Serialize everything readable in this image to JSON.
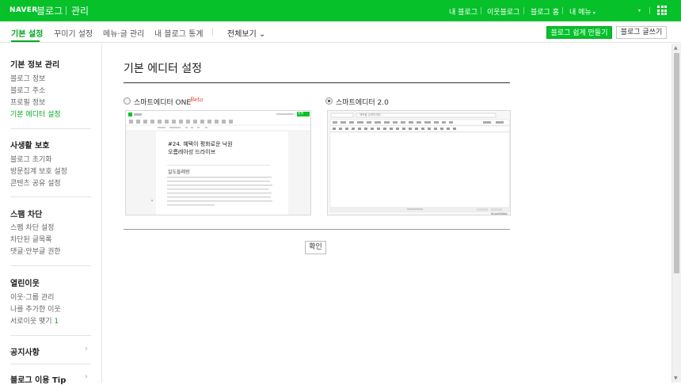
{
  "topbar": {
    "naver": "NAVER",
    "blog": "블로그",
    "manage": "관리",
    "links": [
      "내 블로그",
      "이웃블로그",
      "블로그 홈",
      "내 메뉴"
    ],
    "caret": "▾",
    "more_caret": "▾"
  },
  "subnav": {
    "tabs": [
      "기본 설정",
      "꾸미기 설정",
      "메뉴·글 관리",
      "내 블로그 통계"
    ],
    "view_all": "전체보기",
    "view_all_caret": "⌄",
    "easy_make": "블로그 쉽게 만들기",
    "write": "블로그 글쓰기"
  },
  "sidebar": {
    "sections": [
      {
        "title": "기본 정보 관리",
        "items": [
          "블로그 정보",
          "블로그 주소",
          "프로필 정보",
          "기본 에디터 설정"
        ]
      },
      {
        "title": "사생활 보호",
        "items": [
          "블로그 초기화",
          "방문집계 보호 설정",
          "콘텐츠 공유 설정"
        ]
      },
      {
        "title": "스팸 차단",
        "items": [
          "스팸 차단 설정",
          "차단된 글목록",
          "댓글·안부글 권한"
        ]
      },
      {
        "title": "열린이웃",
        "items": [
          "이웃·그룹 관리",
          "나를 추가한 이웃",
          "서로이웃 맺기"
        ]
      }
    ],
    "mutual_count": "1",
    "notice": "공지사항",
    "tips": "블로그 이용 Tip",
    "chevron": "›"
  },
  "main": {
    "title": "기본 에디터 설정",
    "option_one": "스마트에디터 ONE",
    "beta": "Beta",
    "option_two": "스마트에디터 2.0",
    "confirm": "확인",
    "preview_one": {
      "post_title": "#24. 혜택이 평화로운 낙원",
      "post_title_2": "오름레아성 드라이브",
      "subhead": "일도들레랑",
      "publish_label": "발행"
    },
    "preview_two": {
      "title_placeholder": "제목을 입력하세요.",
      "brand": "SmartEditor"
    }
  },
  "scroll": {
    "up": "▲",
    "down": "▼"
  },
  "colors": {
    "brand_green": "#06c12a",
    "active_green": "#06a724"
  },
  "icons": {
    "apps": "grid-icon",
    "chevron": "chevron-right-icon"
  }
}
